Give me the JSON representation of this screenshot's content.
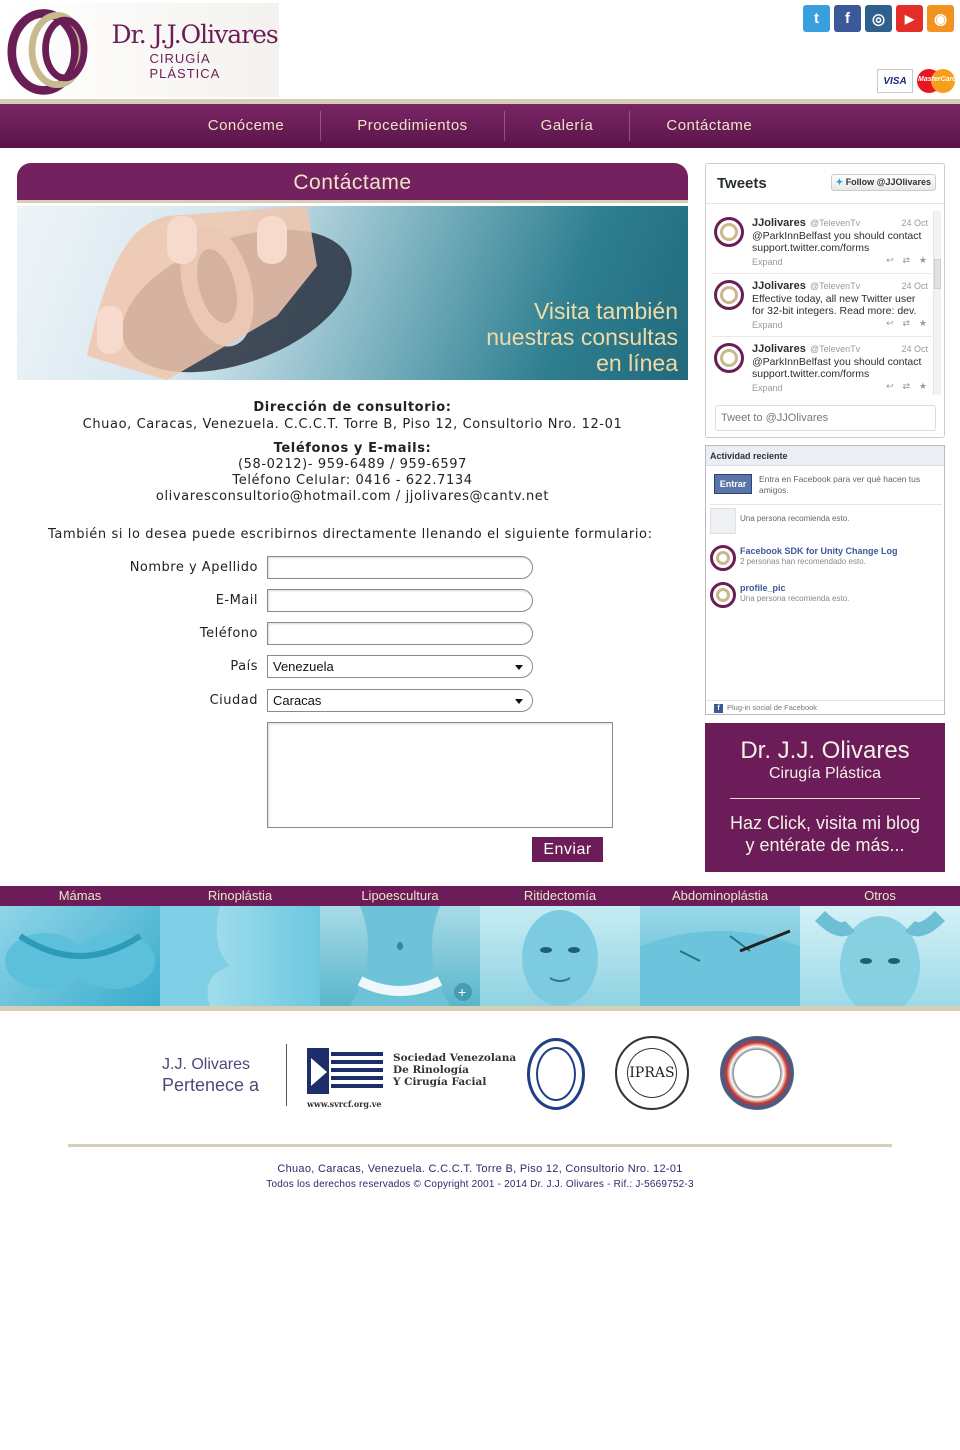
{
  "brand": {
    "name": "Dr. J.J.Olivares",
    "subtitle": "CIRUGÍA PLÁSTICA",
    "primary_color": "#6c1d59",
    "accent_color": "#d7cfb5"
  },
  "social": [
    {
      "icon": "twitter-icon",
      "glyph": "t",
      "color": "#3aa0dd"
    },
    {
      "icon": "facebook-icon",
      "glyph": "f",
      "color": "#3b5998"
    },
    {
      "icon": "instagram-icon",
      "glyph": "◎",
      "color": "#2f5f8c"
    },
    {
      "icon": "youtube-icon",
      "glyph": "▶",
      "color": "#e52d27"
    },
    {
      "icon": "rss-icon",
      "glyph": "◉",
      "color": "#f29221"
    }
  ],
  "payment": {
    "visa": "VISA",
    "mastercard": "MasterCard"
  },
  "nav": [
    "Conóceme",
    "Procedimientos",
    "Galería",
    "Contáctame"
  ],
  "contact": {
    "heading": "Contáctame",
    "banner_text": [
      "Visita también",
      "nuestras consultas",
      "en línea"
    ],
    "address_title": "Dirección de consultorio:",
    "address": "Chuao, Caracas, Venezuela. C.C.C.T. Torre B, Piso 12, Consultorio Nro. 12-01",
    "phones_title": "Teléfonos y E-mails:",
    "phones": "(58-0212)- 959-6489 / 959-6597",
    "cell": "Teléfono Celular: 0416 - 622.7134",
    "emails": "olivaresconsultorio@hotmail.com / jjolivares@cantv.net"
  },
  "form": {
    "intro": "También si lo desea puede escribirnos directamente llenando el siguiente formulario:",
    "name_label": "Nombre y Apellido",
    "email_label": "E-Mail",
    "phone_label": "Teléfono",
    "country_label": "País",
    "country_value": "Venezuela",
    "city_label": "Ciudad",
    "city_value": "Caracas",
    "send_label": "Enviar"
  },
  "tweets": {
    "title": "Tweets",
    "follow": "Follow @JJOlivares",
    "input_placeholder": "Tweet to @JJOlivares",
    "items": [
      {
        "name": "JJolivares",
        "handle": "@TelevenTv",
        "date": "24 Oct",
        "text": "@ParkInnBelfast you should contact support.twitter.com/forms",
        "expand": "Expand"
      },
      {
        "name": "JJolivares",
        "handle": "@TelevenTv",
        "date": "24 Oct",
        "text": "Effective today, all new Twitter user for 32-bit integers. Read more: dev.",
        "expand": "Expand"
      },
      {
        "name": "JJolivares",
        "handle": "@TelevenTv",
        "date": "24 Oct",
        "text": "@ParkInnBelfast you should contact support.twitter.com/forms",
        "expand": "Expand"
      }
    ]
  },
  "facebook": {
    "title": "Actividad reciente",
    "login": "Entrar",
    "login_text": "Entra en Facebook para ver qué hacen tus amigos.",
    "items": [
      {
        "title": "",
        "sub": "Una persona recomienda esto."
      },
      {
        "title": "Facebook SDK for Unity Change Log",
        "sub": "2 personas han recomendado esto."
      },
      {
        "title": "profile_pic",
        "sub": "Una persona recomienda esto."
      }
    ],
    "footer": "Plug-in social de Facebook"
  },
  "blog": {
    "title": "Dr. J.J. Olivares",
    "subtitle": "Cirugía Plástica",
    "cta_1": "Haz Click, visita mi blog",
    "cta_2": "y entérate de más..."
  },
  "procedures": [
    "Mámas",
    "Rinoplástia",
    "Lipoescultura",
    "Ritidectomía",
    "Abdominoplástia",
    "Otros"
  ],
  "affiliations": {
    "line1": "J.J. Olivares",
    "line2": "Pertenece a",
    "svrcf_url": "www.svrcf.org.ve",
    "svrcf_name": [
      "Sociedad Venezolana",
      "De Rinología",
      "Y Cirugía Facial"
    ],
    "ipras": "IPRAS"
  },
  "footer": {
    "address": "Chuao, Caracas, Venezuela. C.C.C.T. Torre B, Piso 12, Consultorio Nro. 12-01",
    "copyright": "Todos los derechos reservados © Copyright 2001 - 2014 Dr. J.J. Olivares - Rif.: J-5669752-3"
  }
}
